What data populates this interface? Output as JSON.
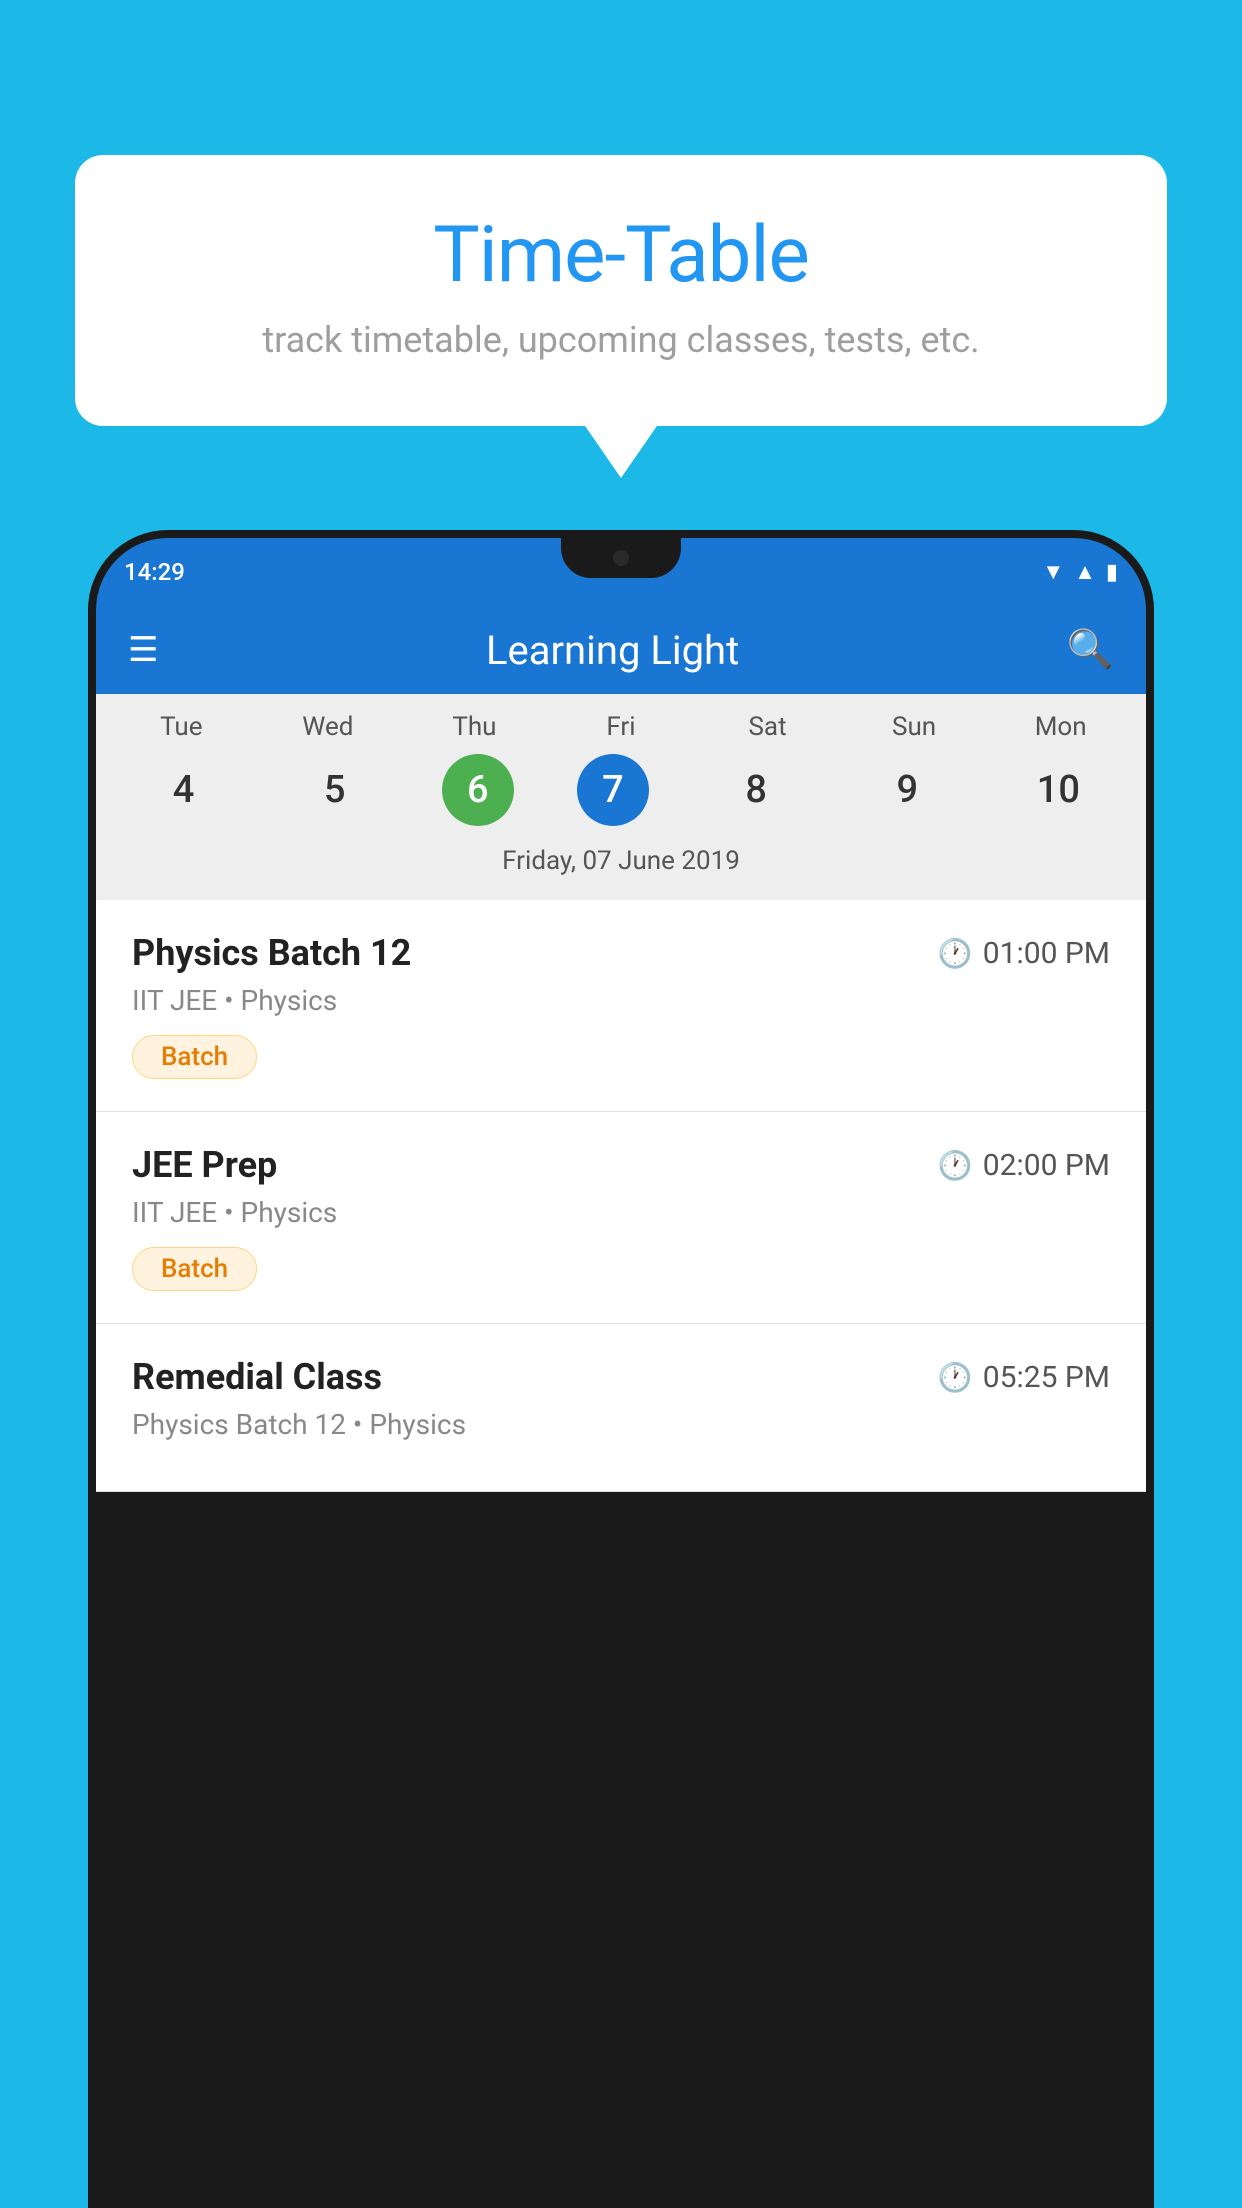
{
  "background_color": "#1BB8E8",
  "bubble": {
    "title": "Time-Table",
    "subtitle": "track timetable, upcoming classes, tests, etc."
  },
  "phone": {
    "status_time": "14:29",
    "app_title": "Learning Light",
    "menu_icon": "☰",
    "search_icon": "🔍"
  },
  "calendar": {
    "days": [
      {
        "label": "Tue",
        "num": "4"
      },
      {
        "label": "Wed",
        "num": "5"
      },
      {
        "label": "Thu",
        "num": "6",
        "state": "today"
      },
      {
        "label": "Fri",
        "num": "7",
        "state": "selected"
      },
      {
        "label": "Sat",
        "num": "8"
      },
      {
        "label": "Sun",
        "num": "9"
      },
      {
        "label": "Mon",
        "num": "10"
      }
    ],
    "selected_date": "Friday, 07 June 2019"
  },
  "schedule": [
    {
      "title": "Physics Batch 12",
      "time": "01:00 PM",
      "subtitle": "IIT JEE • Physics",
      "badge": "Batch"
    },
    {
      "title": "JEE Prep",
      "time": "02:00 PM",
      "subtitle": "IIT JEE • Physics",
      "badge": "Batch"
    },
    {
      "title": "Remedial Class",
      "time": "05:25 PM",
      "subtitle": "Physics Batch 12 • Physics",
      "badge": null
    }
  ]
}
